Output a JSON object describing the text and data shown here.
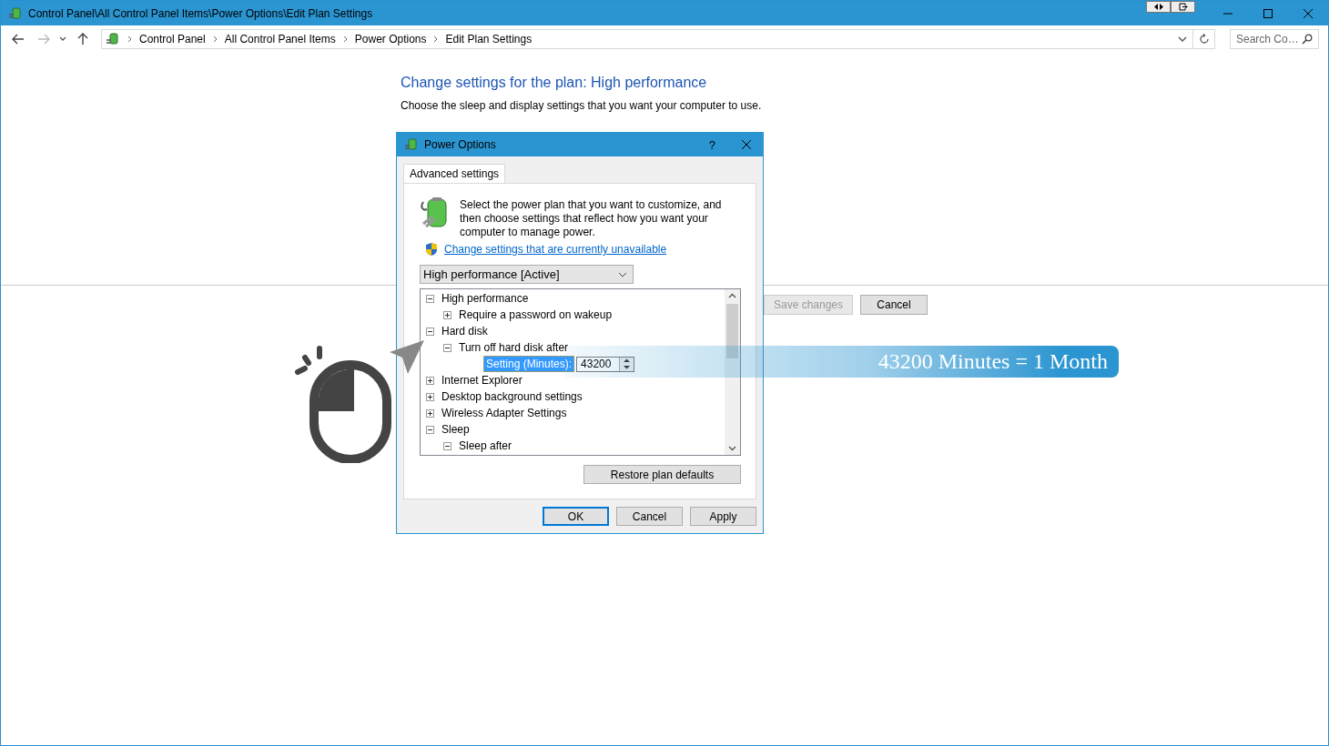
{
  "window": {
    "title": "Control Panel\\All Control Panel Items\\Power Options\\Edit Plan Settings"
  },
  "address_bar": {
    "breadcrumbs": [
      "Control Panel",
      "All Control Panel Items",
      "Power Options",
      "Edit Plan Settings"
    ]
  },
  "search": {
    "placeholder": "Search Co…"
  },
  "page": {
    "heading": "Change settings for the plan: High performance",
    "description": "Choose the sleep and display settings that you want your computer to use.",
    "buttons": [
      {
        "label": "Save changes",
        "disabled": true
      },
      {
        "label": "Cancel",
        "disabled": false
      }
    ]
  },
  "dialog": {
    "title": "Power Options",
    "help": "?",
    "tabs": [
      {
        "label": "Advanced settings",
        "selected": true
      }
    ],
    "intro": "Select the power plan that you want to customize, and then choose settings that reflect how you want your computer to manage power.",
    "link": "Change settings that are currently unavailable",
    "plan_dropdown": {
      "value": "High performance [Active]"
    },
    "tree": [
      {
        "kind": "node",
        "label": "High performance",
        "expanded": true,
        "children": [
          {
            "kind": "node",
            "label": "Require a password on wakeup",
            "expanded": false
          }
        ]
      },
      {
        "kind": "node",
        "label": "Hard disk",
        "expanded": true,
        "children": [
          {
            "kind": "node",
            "label": "Turn off hard disk after",
            "expanded": true,
            "children": [
              {
                "kind": "setting",
                "label": "Setting (Minutes):",
                "value": "43200",
                "selected": true
              }
            ]
          }
        ]
      },
      {
        "kind": "node",
        "label": "Internet Explorer",
        "expanded": false
      },
      {
        "kind": "node",
        "label": "Desktop background settings",
        "expanded": false
      },
      {
        "kind": "node",
        "label": "Wireless Adapter Settings",
        "expanded": false
      },
      {
        "kind": "node",
        "label": "Sleep",
        "expanded": true,
        "children": [
          {
            "kind": "node",
            "label": "Sleep after",
            "expanded": true
          }
        ]
      }
    ],
    "restore_button": "Restore plan defaults",
    "buttons": [
      {
        "label": "OK",
        "default": true
      },
      {
        "label": "Cancel",
        "default": false
      },
      {
        "label": "Apply",
        "default": false
      }
    ]
  },
  "callout": {
    "text": "43200 Minutes = 1 Month"
  }
}
